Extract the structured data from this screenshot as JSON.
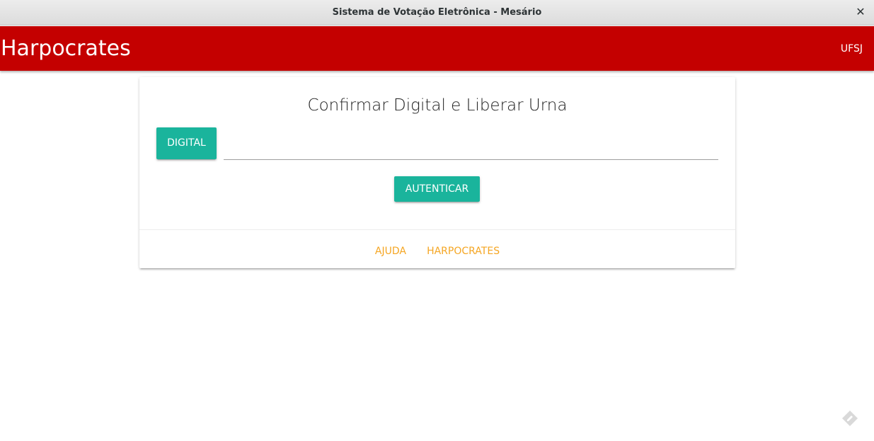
{
  "window": {
    "title": "Sistema de Votação Eletrônica - Mesário",
    "close_glyph": "✕"
  },
  "navbar": {
    "brand": "Harpocrates",
    "right_link": "UFSJ"
  },
  "card": {
    "title": "Confirmar Digital e Liberar Urna",
    "digital_button": "DIGITAL",
    "digital_input": {
      "value": "",
      "placeholder": ""
    },
    "auth_button": "AUTENTICAR",
    "footer_links": [
      "AJUDA",
      "HARPOCRATES"
    ]
  },
  "colors": {
    "navbar_bg": "#c40000",
    "button_bg": "#1ab49c",
    "link": "#f5a623",
    "corner_icon": "#d9d9d9"
  },
  "icons": {
    "close": "close-icon",
    "corner": "pencil-diamond-icon"
  }
}
